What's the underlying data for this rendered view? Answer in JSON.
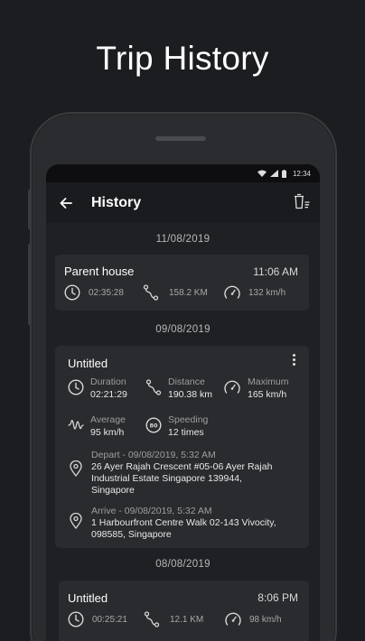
{
  "promo": {
    "title": "Trip History"
  },
  "status": {
    "time": "12:34"
  },
  "appbar": {
    "title": "History"
  },
  "groups": [
    {
      "date": "11/08/2019",
      "trip": {
        "name": "Parent house",
        "time": "11:06 AM",
        "duration": "02:35:28",
        "distance": "158.2 KM",
        "speed": "132 km/h"
      }
    },
    {
      "date": "09/08/2019",
      "trip": {
        "name": "Untitled",
        "duration_label": "Duration",
        "duration": "02:21:29",
        "distance_label": "Distance",
        "distance": "190.38 km",
        "maximum_label": "Maximum",
        "maximum": "165 km/h",
        "average_label": "Average",
        "average": "95 km/h",
        "speeding_label": "Speeding",
        "speeding": "12 times",
        "depart_label": "Depart - 09/08/2019, 5:32 AM",
        "depart_line1": "26 Ayer Rajah Crescent #05-06 Ayer Rajah",
        "depart_line2": "Industrial Estate Singapore 139944,",
        "depart_line3": "Singapore",
        "arrive_label": "Arrive - 09/08/2019, 5:32 AM",
        "arrive_line1": "1 Harbourfront Centre Walk 02-143 Vivocity,",
        "arrive_line2": "098585, Singapore"
      }
    },
    {
      "date": "08/08/2019",
      "trip": {
        "name": "Untitled",
        "time": "8:06 PM",
        "duration": "00:25:21",
        "distance": "12.1 KM",
        "speed": "98 km/h"
      }
    }
  ]
}
